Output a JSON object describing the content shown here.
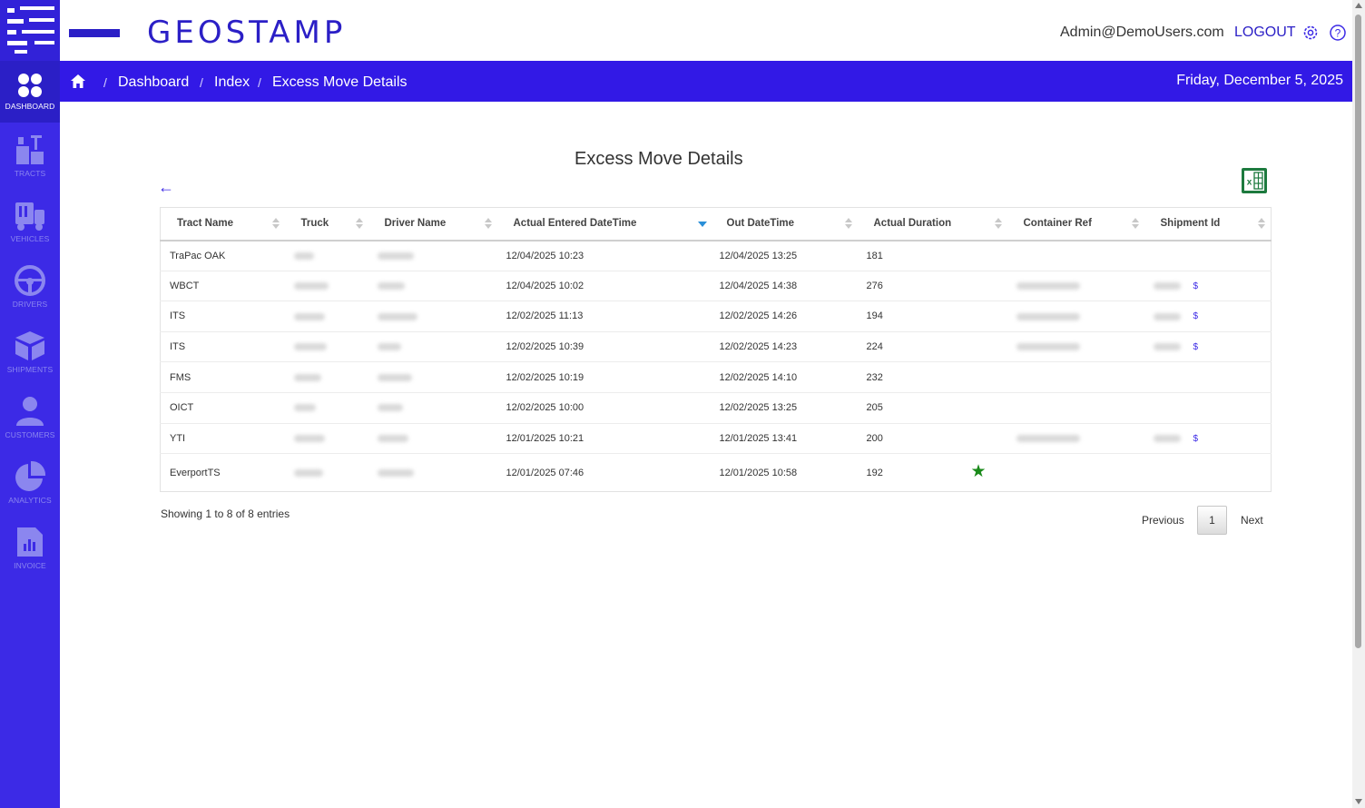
{
  "brand": {
    "name": "GEOSTAMP",
    "accent_color": "#3219e6"
  },
  "header": {
    "user_email": "Admin@DemoUsers.com",
    "logout_label": "LOGOUT",
    "settings_icon": "gear-icon",
    "help_icon": "help-icon"
  },
  "sidebar": {
    "items": [
      {
        "label": "DASHBOARD",
        "icon": "dashboard-icon",
        "active": true
      },
      {
        "label": "TRACTS",
        "icon": "tracts-icon",
        "active": false
      },
      {
        "label": "VEHICLES",
        "icon": "vehicles-icon",
        "active": false
      },
      {
        "label": "DRIVERS",
        "icon": "steering-wheel-icon",
        "active": false
      },
      {
        "label": "SHIPMENTS",
        "icon": "package-icon",
        "active": false
      },
      {
        "label": "CUSTOMERS",
        "icon": "person-icon",
        "active": false
      },
      {
        "label": "ANALYTICS",
        "icon": "pie-chart-icon",
        "active": false
      },
      {
        "label": "INVOICE",
        "icon": "invoice-icon",
        "active": false
      }
    ]
  },
  "breadcrumb": {
    "items": [
      "Dashboard",
      "Index",
      "Excess Move Details"
    ],
    "date": "Friday, December 5, 2025"
  },
  "main": {
    "title": "Excess Move Details",
    "table": {
      "columns": [
        "Tract Name",
        "Truck",
        "Driver Name",
        "Actual Entered DateTime",
        "Out DateTime",
        "Actual Duration",
        "Container Ref",
        "Shipment Id"
      ],
      "sorted_column": "Actual Entered DateTime",
      "sort_direction": "desc",
      "rows": [
        {
          "tract": "TraPac OAK",
          "entered": "12/04/2025 10:23",
          "out": "12/04/2025 13:25",
          "duration": "181",
          "has_container": false,
          "has_shipment": false,
          "starred": false
        },
        {
          "tract": "WBCT",
          "entered": "12/04/2025 10:02",
          "out": "12/04/2025 14:38",
          "duration": "276",
          "has_container": true,
          "has_shipment": true,
          "starred": false
        },
        {
          "tract": "ITS",
          "entered": "12/02/2025 11:13",
          "out": "12/02/2025 14:26",
          "duration": "194",
          "has_container": true,
          "has_shipment": true,
          "starred": false
        },
        {
          "tract": "ITS",
          "entered": "12/02/2025 10:39",
          "out": "12/02/2025 14:23",
          "duration": "224",
          "has_container": true,
          "has_shipment": true,
          "starred": false
        },
        {
          "tract": "FMS",
          "entered": "12/02/2025 10:19",
          "out": "12/02/2025 14:10",
          "duration": "232",
          "has_container": false,
          "has_shipment": false,
          "starred": false
        },
        {
          "tract": "OICT",
          "entered": "12/02/2025 10:00",
          "out": "12/02/2025 13:25",
          "duration": "205",
          "has_container": false,
          "has_shipment": false,
          "starred": false
        },
        {
          "tract": "YTI",
          "entered": "12/01/2025 10:21",
          "out": "12/01/2025 13:41",
          "duration": "200",
          "has_container": true,
          "has_shipment": true,
          "starred": false
        },
        {
          "tract": "EverportTS",
          "entered": "12/01/2025 07:46",
          "out": "12/01/2025 10:58",
          "duration": "192",
          "has_container": false,
          "has_shipment": false,
          "starred": true
        }
      ],
      "shipment_link_symbol": "$",
      "star_color": "#1a8a1a"
    },
    "info": "Showing 1 to 8 of 8 entries",
    "pagination": {
      "previous": "Previous",
      "current": "1",
      "next": "Next"
    }
  }
}
